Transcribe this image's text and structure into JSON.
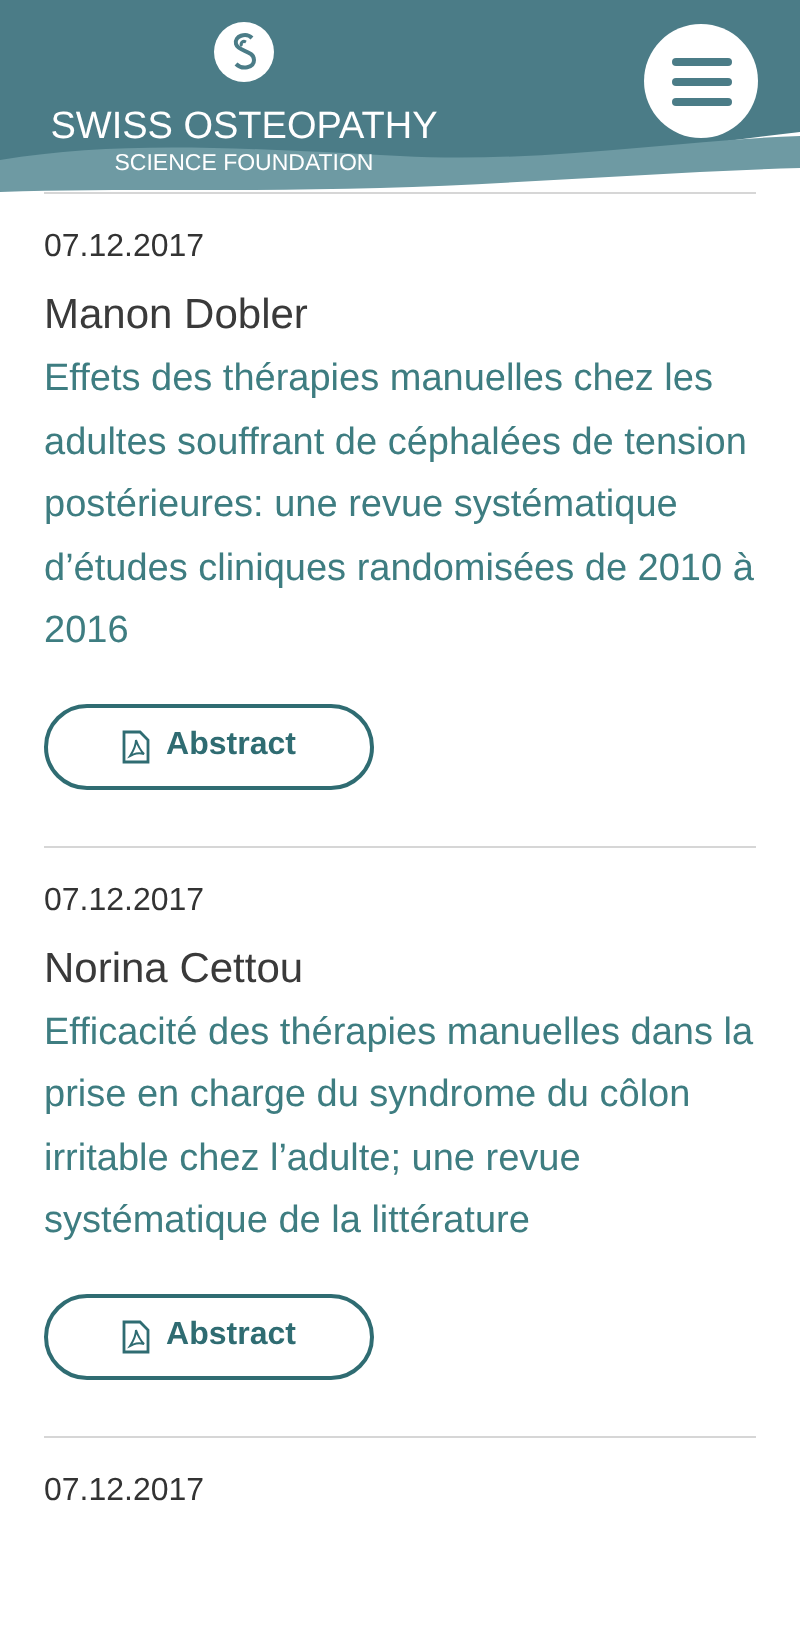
{
  "header": {
    "brand_line_1": "SWISS OSTEOPATHY",
    "brand_line_2": "SCIENCE FOUNDATION"
  },
  "entries": [
    {
      "date": "07.12.2017",
      "author": "Manon Dobler",
      "title": "Effets des thérapies manuelles chez les adultes souffrant de céphalées de tension postérieures: une revue systématique d’études cliniques randomisées de 2010 à 2016",
      "button": "Abstract"
    },
    {
      "date": "07.12.2017",
      "author": "Norina Cettou",
      "title": "Efficacité des thérapies manuelles dans la prise en charge du syndrome du côlon irritable chez l’adulte; une revue systématique de la littérature",
      "button": "Abstract"
    },
    {
      "date": "07.12.2017"
    }
  ]
}
